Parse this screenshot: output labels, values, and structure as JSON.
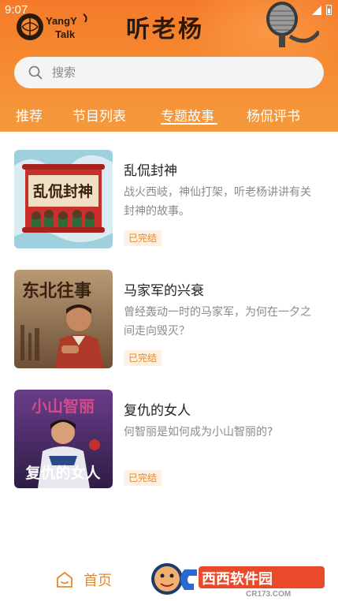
{
  "status_bar": {
    "time": "9:07"
  },
  "header": {
    "logo_text_top": "YangY",
    "logo_text_bottom": "Talk",
    "title": "听老杨"
  },
  "search": {
    "placeholder": "搜索"
  },
  "tabs": [
    {
      "label": "推荐"
    },
    {
      "label": "节目列表"
    },
    {
      "label": "专题故事",
      "active": true
    },
    {
      "label": "杨侃评书"
    }
  ],
  "items": [
    {
      "title": "乱侃封神",
      "desc": "战火西岐，神仙打架，听老杨讲讲有关封神的故事。",
      "badge": "已完结",
      "cover_text": "乱侃封神"
    },
    {
      "title": "马家军的兴衰",
      "desc": "曾经轰动一时的马家军，为何在一夕之间走向毁灭？",
      "badge": "已完结",
      "cover_text": "东北往事"
    },
    {
      "title": "复仇的女人",
      "desc": "何智丽是如何成为小山智丽的?",
      "badge": "已完结",
      "cover_text_top": "小山智丽",
      "cover_text_bottom": "复仇的女人"
    }
  ],
  "bottom_nav": {
    "home_label": "首页"
  },
  "watermark": {
    "brand": "西西软件园",
    "url": "CR173.COM"
  },
  "colors": {
    "header_orange": "#f5872f",
    "accent": "#e8872a",
    "badge_bg": "#fdf1e3"
  }
}
